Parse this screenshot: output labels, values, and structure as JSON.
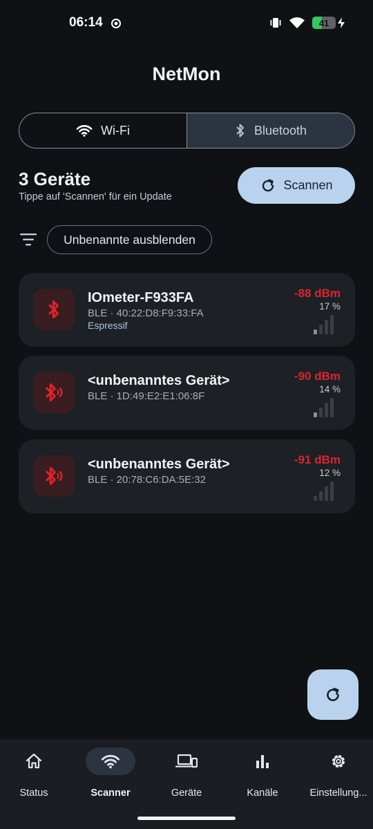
{
  "status_bar": {
    "time": "06:14",
    "battery": "41",
    "battery_level": 0.41,
    "icons": [
      "vibrate-icon",
      "wifi-icon",
      "battery-icon",
      "charging-icon"
    ]
  },
  "app": {
    "title": "NetMon",
    "accent": "#b9d3ef"
  },
  "tabs": [
    {
      "label": "Wi-Fi",
      "icon": "wifi-icon",
      "selected": false
    },
    {
      "label": "Bluetooth",
      "icon": "bluetooth-icon",
      "selected": true
    }
  ],
  "summary": {
    "count": "3 Geräte",
    "hint": "Tippe auf 'Scannen' für ein Update",
    "scan_label": "Scannen"
  },
  "filter": {
    "chip_label": "Unbenannte ausblenden"
  },
  "devices": [
    {
      "name": "IOmeter-F933FA",
      "sub": "BLE · 40:22:D8:F9:33:FA",
      "vendor": "Espressif",
      "dbm": "-88 dBm",
      "percent": "17 %",
      "signal_level": 0.17,
      "icon": "bluetooth-icon"
    },
    {
      "name": "<unbenanntes Gerät>",
      "sub": "BLE · 1D:49:E2:E1:06:8F",
      "vendor": "",
      "dbm": "-90 dBm",
      "percent": "14 %",
      "signal_level": 0.14,
      "icon": "bluetooth-audio-icon"
    },
    {
      "name": "<unbenanntes Gerät>",
      "sub": "BLE · 20:78:C6:DA:5E:32",
      "vendor": "",
      "dbm": "-91 dBm",
      "percent": "12 %",
      "signal_level": 0.12,
      "icon": "bluetooth-audio-icon"
    }
  ],
  "colors": {
    "signal_weak": "#e0222a"
  },
  "nav": [
    {
      "label": "Status",
      "icon": "home-icon",
      "active": false
    },
    {
      "label": "Scanner",
      "icon": "wifi-icon",
      "active": true
    },
    {
      "label": "Geräte",
      "icon": "devices-icon",
      "active": false
    },
    {
      "label": "Kanäle",
      "icon": "bar-chart-icon",
      "active": false
    },
    {
      "label": "Einstellung...",
      "icon": "gear-icon",
      "active": false
    }
  ]
}
